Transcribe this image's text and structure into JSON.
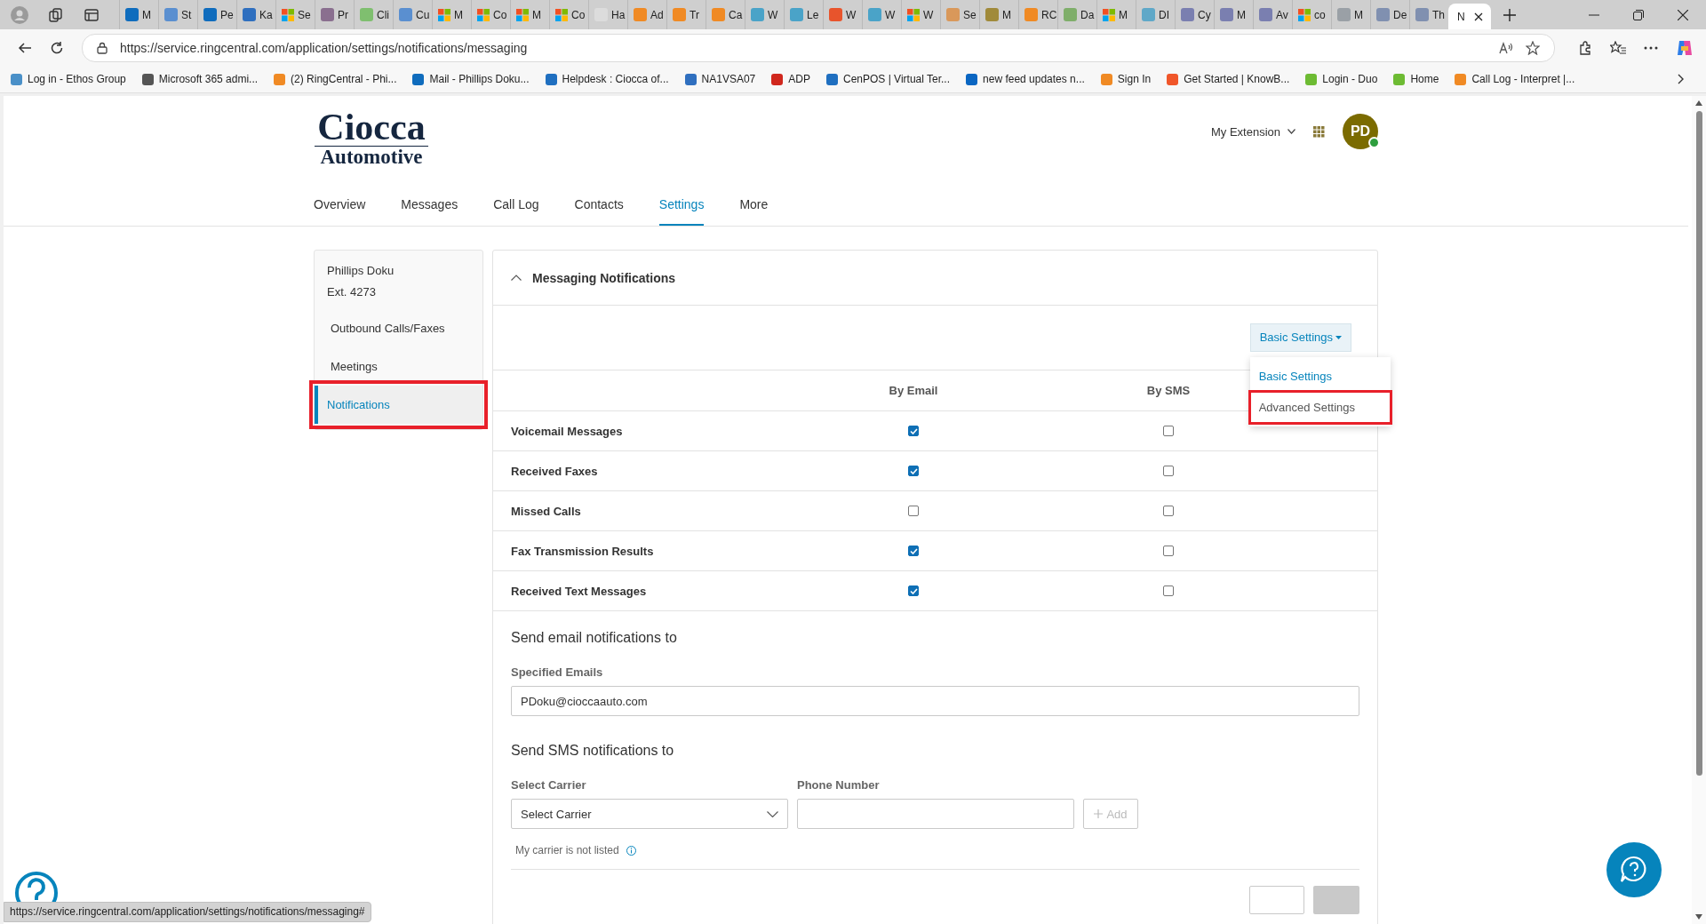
{
  "browser": {
    "tabs": [
      {
        "label": "M",
        "kind": "square",
        "color": "#0f6cbd",
        "selected": false
      },
      {
        "label": "St",
        "kind": "square",
        "color": "#5a8fd0",
        "selected": false
      },
      {
        "label": "Pe",
        "kind": "square",
        "color": "#0f6cbd",
        "selected": false
      },
      {
        "label": "Ka",
        "kind": "square",
        "color": "#2f6fbf",
        "selected": false
      },
      {
        "label": "Se",
        "kind": "grid",
        "selected": false
      },
      {
        "label": "Pr",
        "kind": "square",
        "color": "#8a6f8f",
        "selected": false
      },
      {
        "label": "Cli",
        "kind": "square",
        "color": "#7fbf6f",
        "selected": false
      },
      {
        "label": "Cu",
        "kind": "square",
        "color": "#5a8fd0",
        "selected": false
      },
      {
        "label": "M",
        "kind": "grid",
        "selected": false
      },
      {
        "label": "Co",
        "kind": "grid",
        "selected": false
      },
      {
        "label": "M",
        "kind": "grid",
        "selected": false
      },
      {
        "label": "Co",
        "kind": "grid",
        "selected": false
      },
      {
        "label": "Ha",
        "kind": "square",
        "color": "#dcdcdc",
        "selected": false
      },
      {
        "label": "Ad",
        "kind": "square",
        "color": "#f08a24",
        "selected": false
      },
      {
        "label": "Tr",
        "kind": "square",
        "color": "#f08a24",
        "selected": false
      },
      {
        "label": "Ca",
        "kind": "square",
        "color": "#f08a24",
        "selected": false
      },
      {
        "label": "W",
        "kind": "square",
        "color": "#4aa3c8",
        "selected": false
      },
      {
        "label": "Le",
        "kind": "square",
        "color": "#4aa3c8",
        "selected": false
      },
      {
        "label": "W",
        "kind": "square",
        "color": "#e8542c",
        "selected": false
      },
      {
        "label": "W",
        "kind": "square",
        "color": "#4aa3c8",
        "selected": false
      },
      {
        "label": "W",
        "kind": "grid",
        "selected": false
      },
      {
        "label": "Se",
        "kind": "square",
        "color": "#d9985a",
        "selected": false
      },
      {
        "label": "M",
        "kind": "square",
        "color": "#a08a3a",
        "selected": false
      },
      {
        "label": "RC",
        "kind": "square",
        "color": "#f08a24",
        "selected": false
      },
      {
        "label": "Da",
        "kind": "square",
        "color": "#7fae6a",
        "selected": false
      },
      {
        "label": "M",
        "kind": "grid",
        "selected": false
      },
      {
        "label": "DI",
        "kind": "square",
        "color": "#5fa8c8",
        "selected": false
      },
      {
        "label": "Cy",
        "kind": "square",
        "color": "#7a7fb0",
        "selected": false
      },
      {
        "label": "M",
        "kind": "square",
        "color": "#7a7fb0",
        "selected": false
      },
      {
        "label": "Av",
        "kind": "square",
        "color": "#7a7fb0",
        "selected": false
      },
      {
        "label": "co",
        "kind": "grid",
        "selected": false
      },
      {
        "label": "M",
        "kind": "square",
        "color": "#9aa0a6",
        "selected": false
      },
      {
        "label": "De",
        "kind": "square",
        "color": "#8090b0",
        "selected": false
      },
      {
        "label": "Th",
        "kind": "square",
        "color": "#8090b0",
        "selected": false
      },
      {
        "label": "N",
        "kind": "none",
        "selected": true
      }
    ],
    "address": "https://service.ringcentral.com/application/settings/notifications/messaging",
    "bookmarks": [
      {
        "label": "Log in - Ethos Group",
        "color": "#4a90c8"
      },
      {
        "label": "Microsoft 365 admi...",
        "color": "#555555"
      },
      {
        "label": "(2) RingCentral - Phi...",
        "color": "#f08a24"
      },
      {
        "label": "Mail - Phillips Doku...",
        "color": "#0f6cbd"
      },
      {
        "label": "Helpdesk : Ciocca of...",
        "color": "#1f6fc0"
      },
      {
        "label": "NA1VSA07",
        "color": "#2f6fbf"
      },
      {
        "label": "ADP",
        "color": "#d0271d"
      },
      {
        "label": "CenPOS | Virtual Ter...",
        "color": "#1f6fc0"
      },
      {
        "label": "new feed updates n...",
        "color": "#0a66c2"
      },
      {
        "label": "Sign In",
        "color": "#f08a24"
      },
      {
        "label": "Get Started | KnowB...",
        "color": "#f0562a"
      },
      {
        "label": "Login - Duo",
        "color": "#6dbb33"
      },
      {
        "label": "Home",
        "color": "#6dbb33"
      },
      {
        "label": "Call Log - Interpret |...",
        "color": "#f08a24"
      }
    ],
    "status_url": "https://service.ringcentral.com/application/settings/notifications/messaging#"
  },
  "header": {
    "logo_line1": "Ciocca",
    "logo_line2": "Automotive",
    "extension_menu": "My Extension",
    "avatar": "PD",
    "online": true
  },
  "nav": [
    {
      "label": "Overview",
      "selected": false
    },
    {
      "label": "Messages",
      "selected": false
    },
    {
      "label": "Call Log",
      "selected": false
    },
    {
      "label": "Contacts",
      "selected": false
    },
    {
      "label": "Settings",
      "selected": true
    },
    {
      "label": "More",
      "selected": false
    }
  ],
  "sidebar": {
    "user_name": "Phillips Doku",
    "extension": "Ext. 4273",
    "items": [
      {
        "label": "Outbound Calls/Faxes",
        "selected": false,
        "highlighted": false
      },
      {
        "label": "Meetings",
        "selected": false,
        "highlighted": false
      },
      {
        "label": "Notifications",
        "selected": true,
        "highlighted": true
      }
    ]
  },
  "panel": {
    "title": "Messaging Notifications",
    "expanded": true,
    "settings_dropdown": {
      "label": "Basic Settings",
      "open": true,
      "options": [
        {
          "label": "Basic Settings",
          "selected": true,
          "highlighted": false
        },
        {
          "label": "Advanced Settings",
          "selected": false,
          "highlighted": true
        }
      ]
    },
    "columns": [
      "By Email",
      "By SMS"
    ],
    "rows": [
      {
        "label": "Voicemail Messages",
        "email": true,
        "sms": false
      },
      {
        "label": "Received Faxes",
        "email": true,
        "sms": false
      },
      {
        "label": "Missed Calls",
        "email": false,
        "sms": false
      },
      {
        "label": "Fax Transmission Results",
        "email": true,
        "sms": false
      },
      {
        "label": "Received Text Messages",
        "email": true,
        "sms": false
      }
    ],
    "email_section": {
      "heading": "Send email notifications to",
      "field_label": "Specified Emails",
      "value": "PDoku@cioccaauto.com"
    },
    "sms_section": {
      "heading": "Send SMS notifications to",
      "carrier_label": "Select Carrier",
      "carrier_value": "Select Carrier",
      "phone_label": "Phone Number",
      "add_button": "Add",
      "not_listed_link": "My carrier is not listed"
    }
  }
}
